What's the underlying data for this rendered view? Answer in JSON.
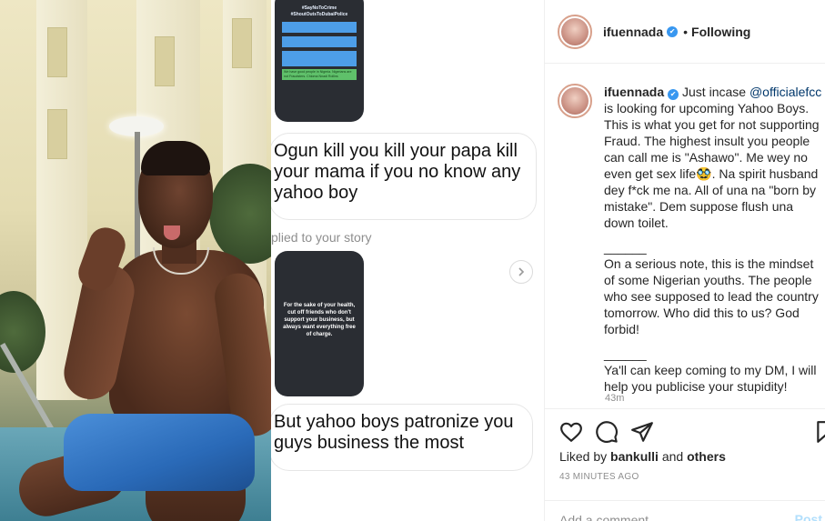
{
  "story_top": {
    "headline_lines": [
      "#SayNoToCrime",
      "#ShoutOutsToDubaiPolice"
    ],
    "green_text": "We have good people in Nigeria. Nigerians are not Fraudsters. Chioma Nnadi Rollins"
  },
  "dm": {
    "message1": "Ogun kill you kill your papa kill your mama if you no know any yahoo boy",
    "replied_label": "plied to your story",
    "story2_text": "For the sake of your health, cut off friends who don't support your business, but always want everything free of charge.",
    "message2": "But yahoo boys patronize you guys business the most"
  },
  "post": {
    "username": "ifuennada",
    "verified": "✔",
    "dot": "•",
    "follow_status": "Following",
    "caption": {
      "username": "ifuennada",
      "p1_pre": "Just incase ",
      "mention": "@officialefcc",
      "p1_post": " is looking for upcoming Yahoo Boys. This is what you get for not supporting Fraud. The highest insult you people can call me is \"Ashawo\". Me wey no even get sex life🥸. Na spirit husband dey f*ck me na. All of una na \"born by mistake\". Dem suppose flush una down toilet.",
      "divider1": "______",
      "p2": "On a serious note, this is the mindset of some Nigerian youths. The people who see supposed to lead the country tomorrow. Who did this to us? God forbid!",
      "divider2": "______",
      "p3": "Ya'll can keep coming to my DM, I will help you publicise your stupidity!"
    },
    "caption_time": "43m",
    "liked_prefix": "Liked by ",
    "liked_user": "bankulli",
    "liked_and": " and ",
    "liked_others": "others",
    "time_ago": "43 MINUTES AGO",
    "comment_placeholder": "Add a comment…",
    "post_label": "Post"
  },
  "icons": [
    "heart-icon",
    "comment-icon",
    "share-icon",
    "bookmark-icon",
    "verified-badge-icon",
    "share-story-icon"
  ]
}
